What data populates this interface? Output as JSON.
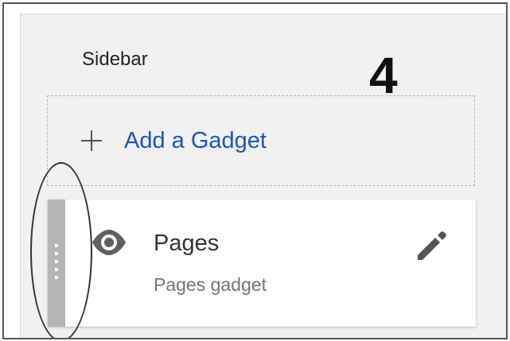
{
  "sidebar": {
    "title": "Sidebar",
    "add_gadget_label": "Add a Gadget"
  },
  "annotation": {
    "step_number": "4"
  },
  "gadget": {
    "title": "Pages",
    "subtitle": "Pages gadget"
  },
  "icons": {
    "add": "plus-icon",
    "visibility": "eye-icon",
    "edit": "pencil-icon",
    "drag": "drag-handle-icon"
  },
  "colors": {
    "link_blue": "#1a57b7",
    "panel_background": "#f1f1f1",
    "handle_gray": "#b5b5b5",
    "text_dark": "#333333",
    "text_muted": "#747474"
  }
}
